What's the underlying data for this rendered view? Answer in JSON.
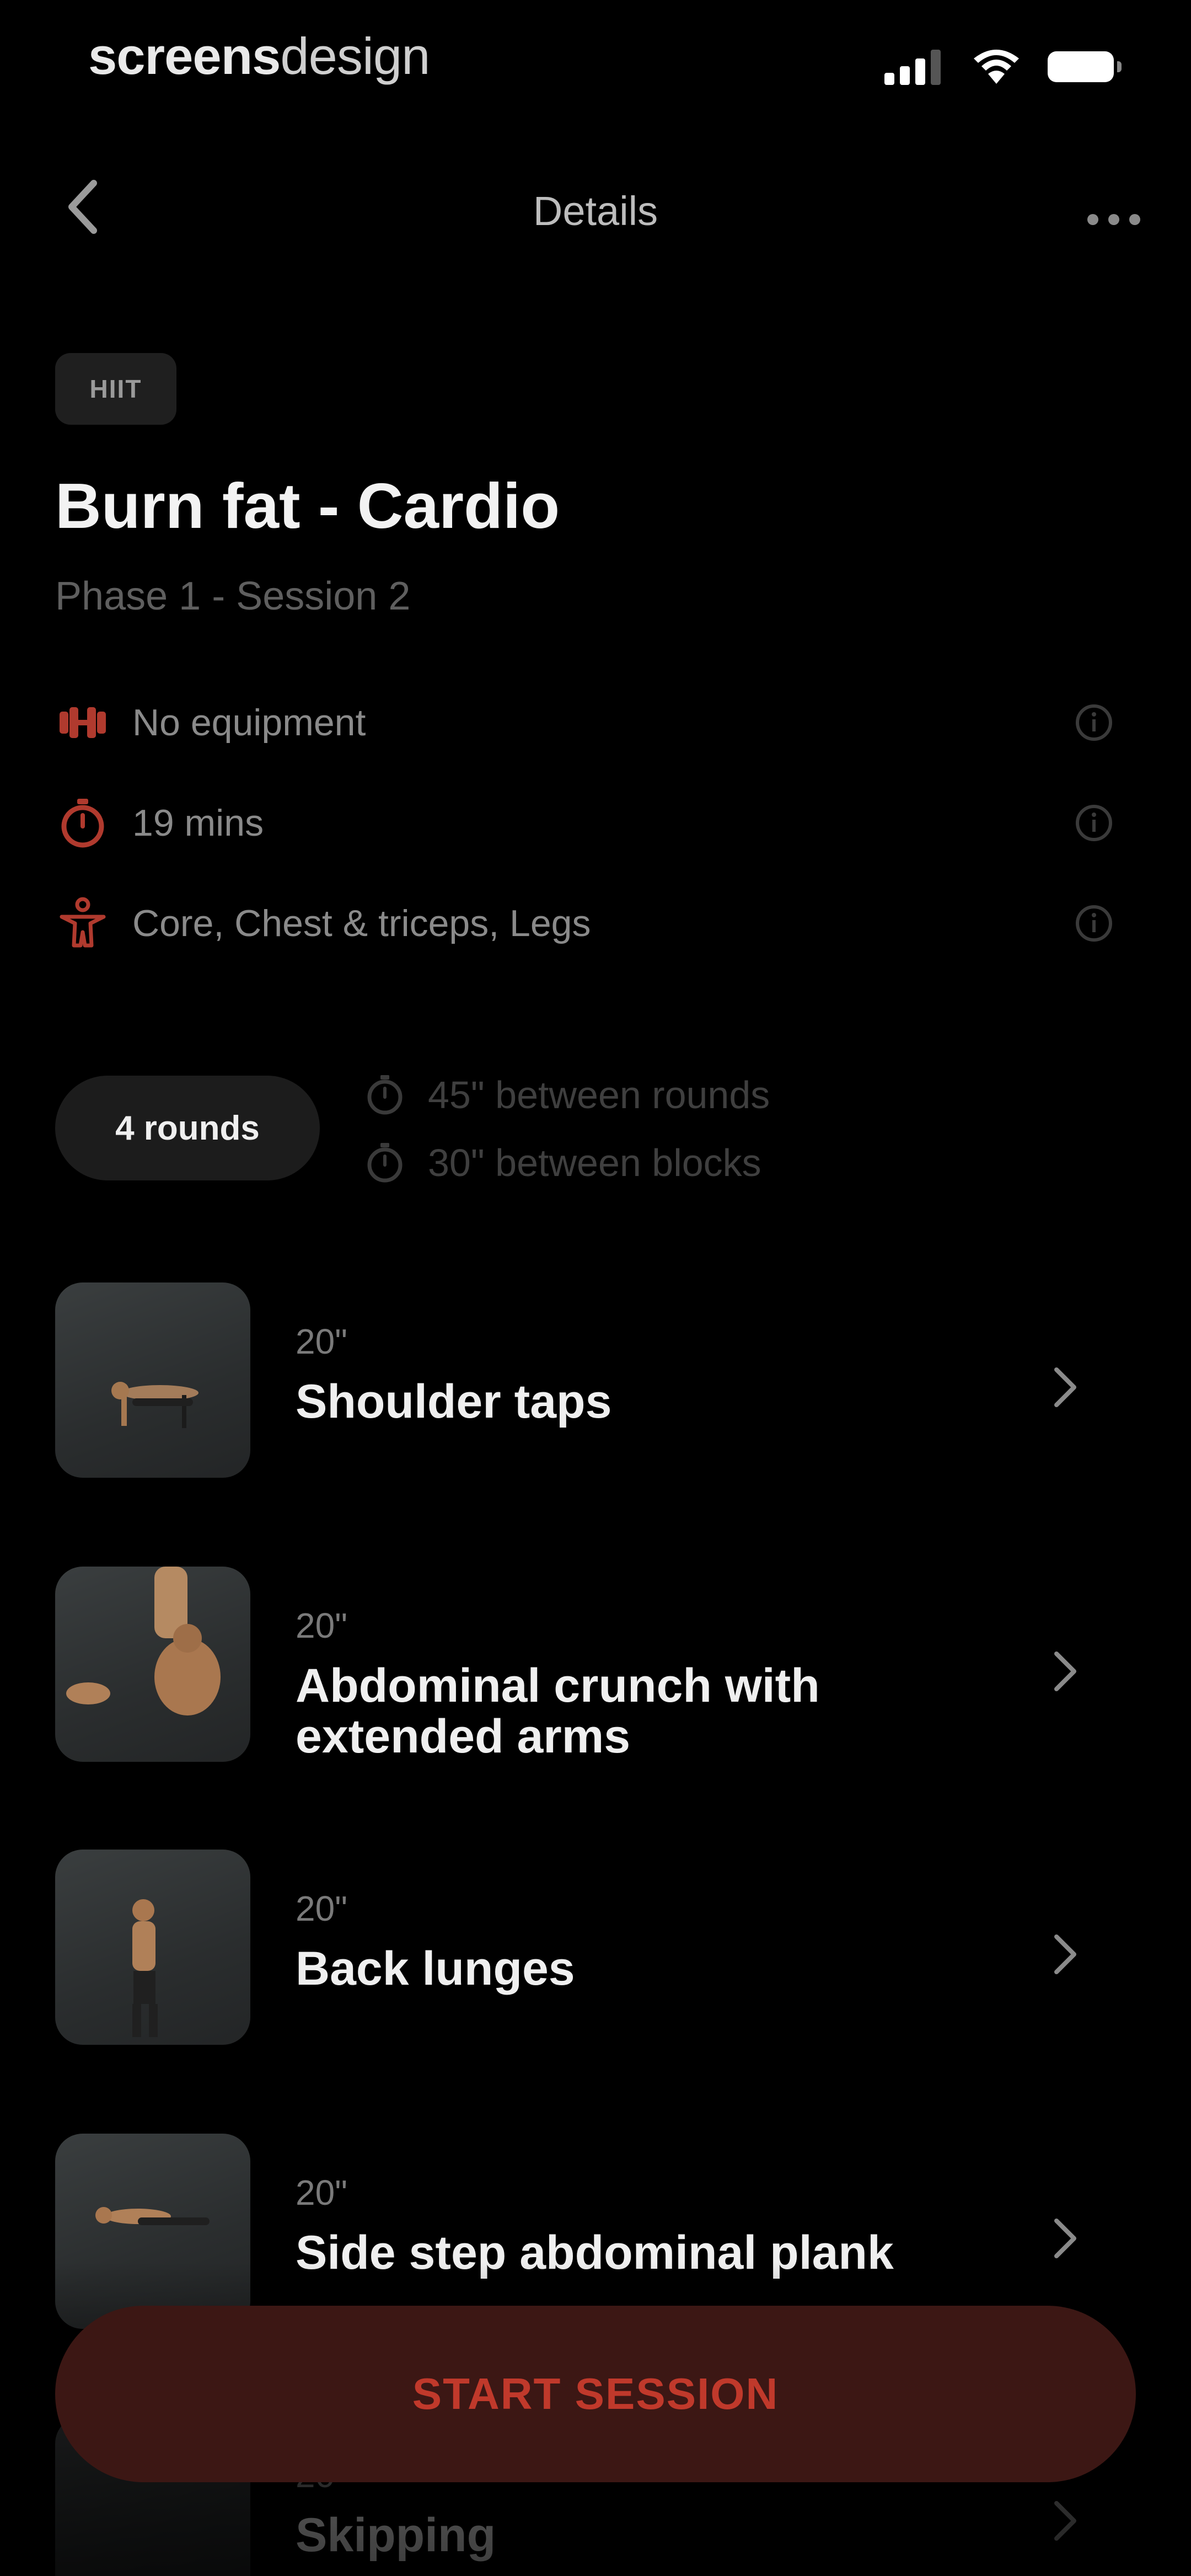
{
  "status_bar": {
    "brand_bold": "screens",
    "brand_light": "design"
  },
  "nav": {
    "title": "Details"
  },
  "workout": {
    "tag": "HIIT",
    "title": "Burn fat - Cardio",
    "subtitle": "Phase 1 - Session 2",
    "info": [
      {
        "icon": "dumbbell-icon",
        "text": "No equipment"
      },
      {
        "icon": "stopwatch-icon",
        "text": "19 mins"
      },
      {
        "icon": "body-icon",
        "text": "Core, Chest & triceps, Legs"
      }
    ]
  },
  "rounds": {
    "label": "4 rounds",
    "rest": [
      {
        "text": "45\" between rounds"
      },
      {
        "text": "30\" between blocks"
      }
    ]
  },
  "exercises": [
    {
      "duration": "20\"",
      "name": "Shoulder taps"
    },
    {
      "duration": "20\"",
      "name": "Abdominal crunch with extended arms"
    },
    {
      "duration": "20\"",
      "name": "Back lunges"
    },
    {
      "duration": "20\"",
      "name": "Side step abdominal plank"
    },
    {
      "duration": "20\"",
      "name": "Skipping"
    }
  ],
  "cta": {
    "label": "START SESSION"
  },
  "colors": {
    "accent": "#c0392b",
    "background": "#000000",
    "cta_bg": "#3c1714"
  }
}
